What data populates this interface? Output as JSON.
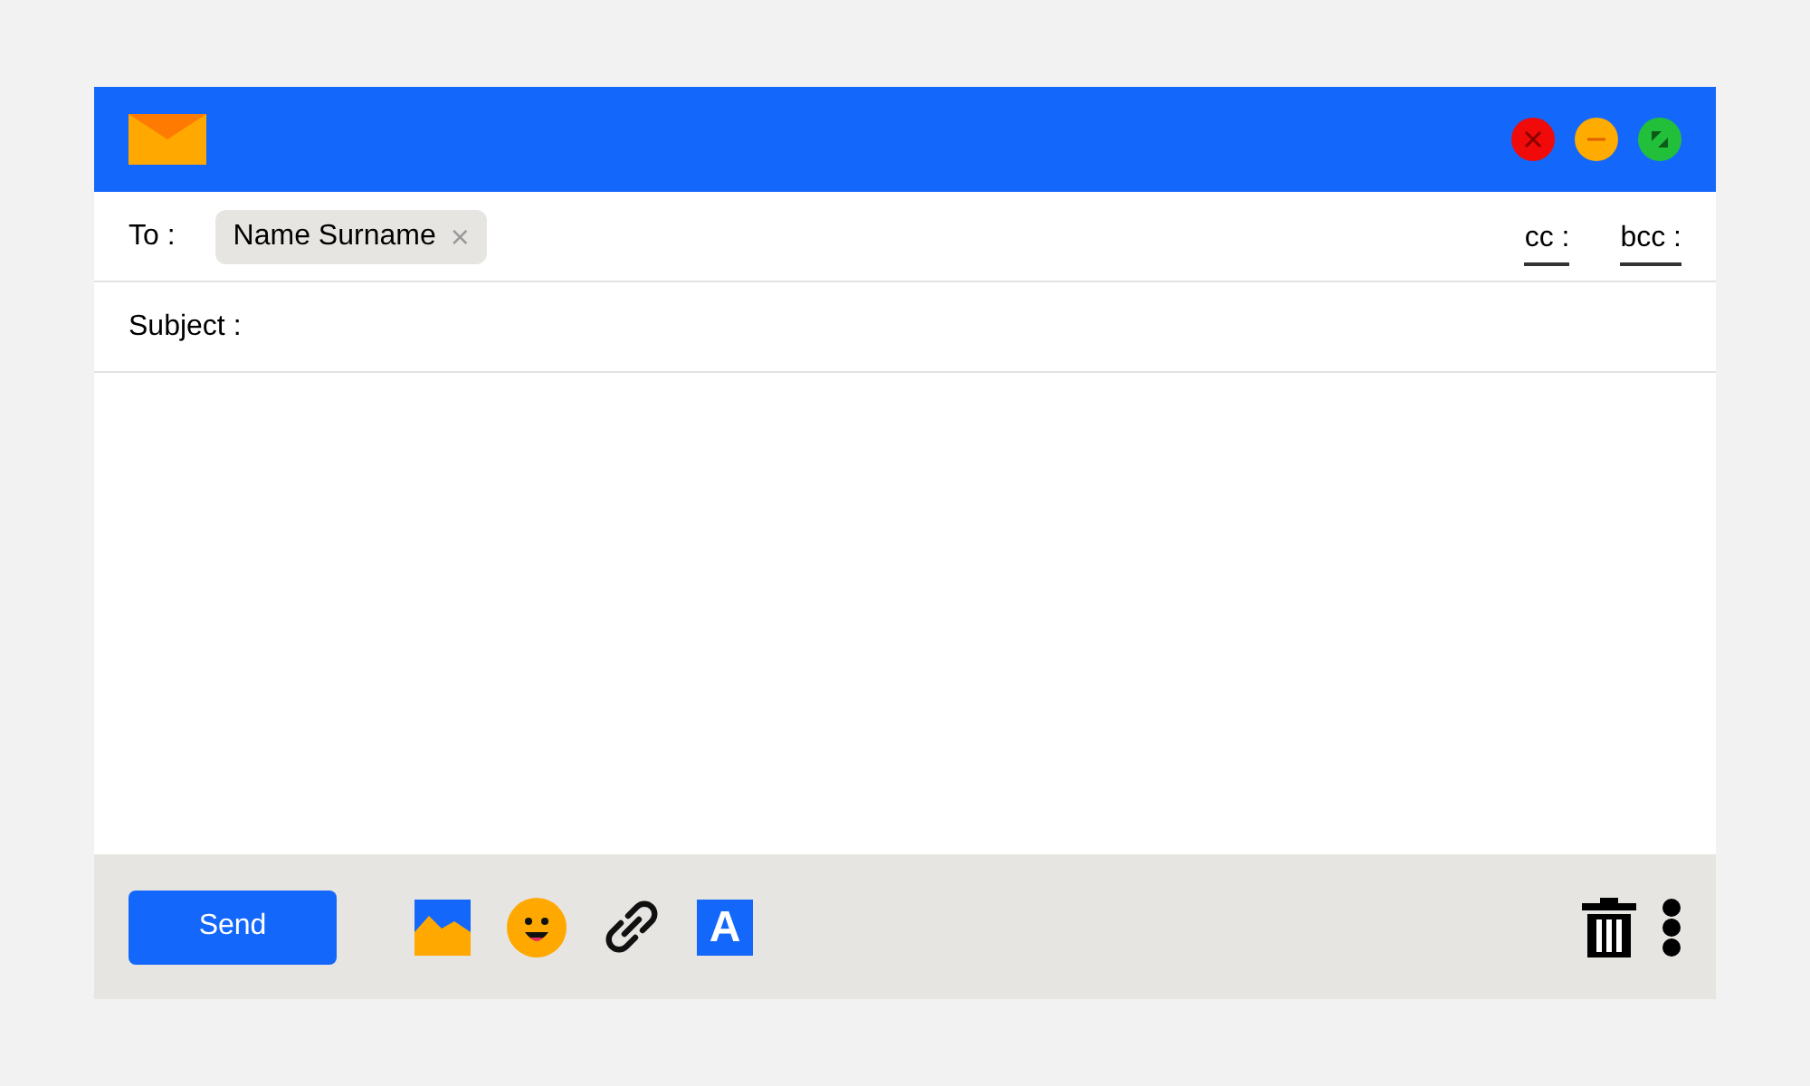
{
  "to": {
    "label": "To :",
    "recipients": [
      {
        "name": "Name Surname",
        "remove": "×"
      }
    ],
    "cc": "cc :",
    "bcc": "bcc :"
  },
  "subject": {
    "label": "Subject :"
  },
  "toolbar": {
    "send": "Send",
    "format_letter": "A"
  }
}
